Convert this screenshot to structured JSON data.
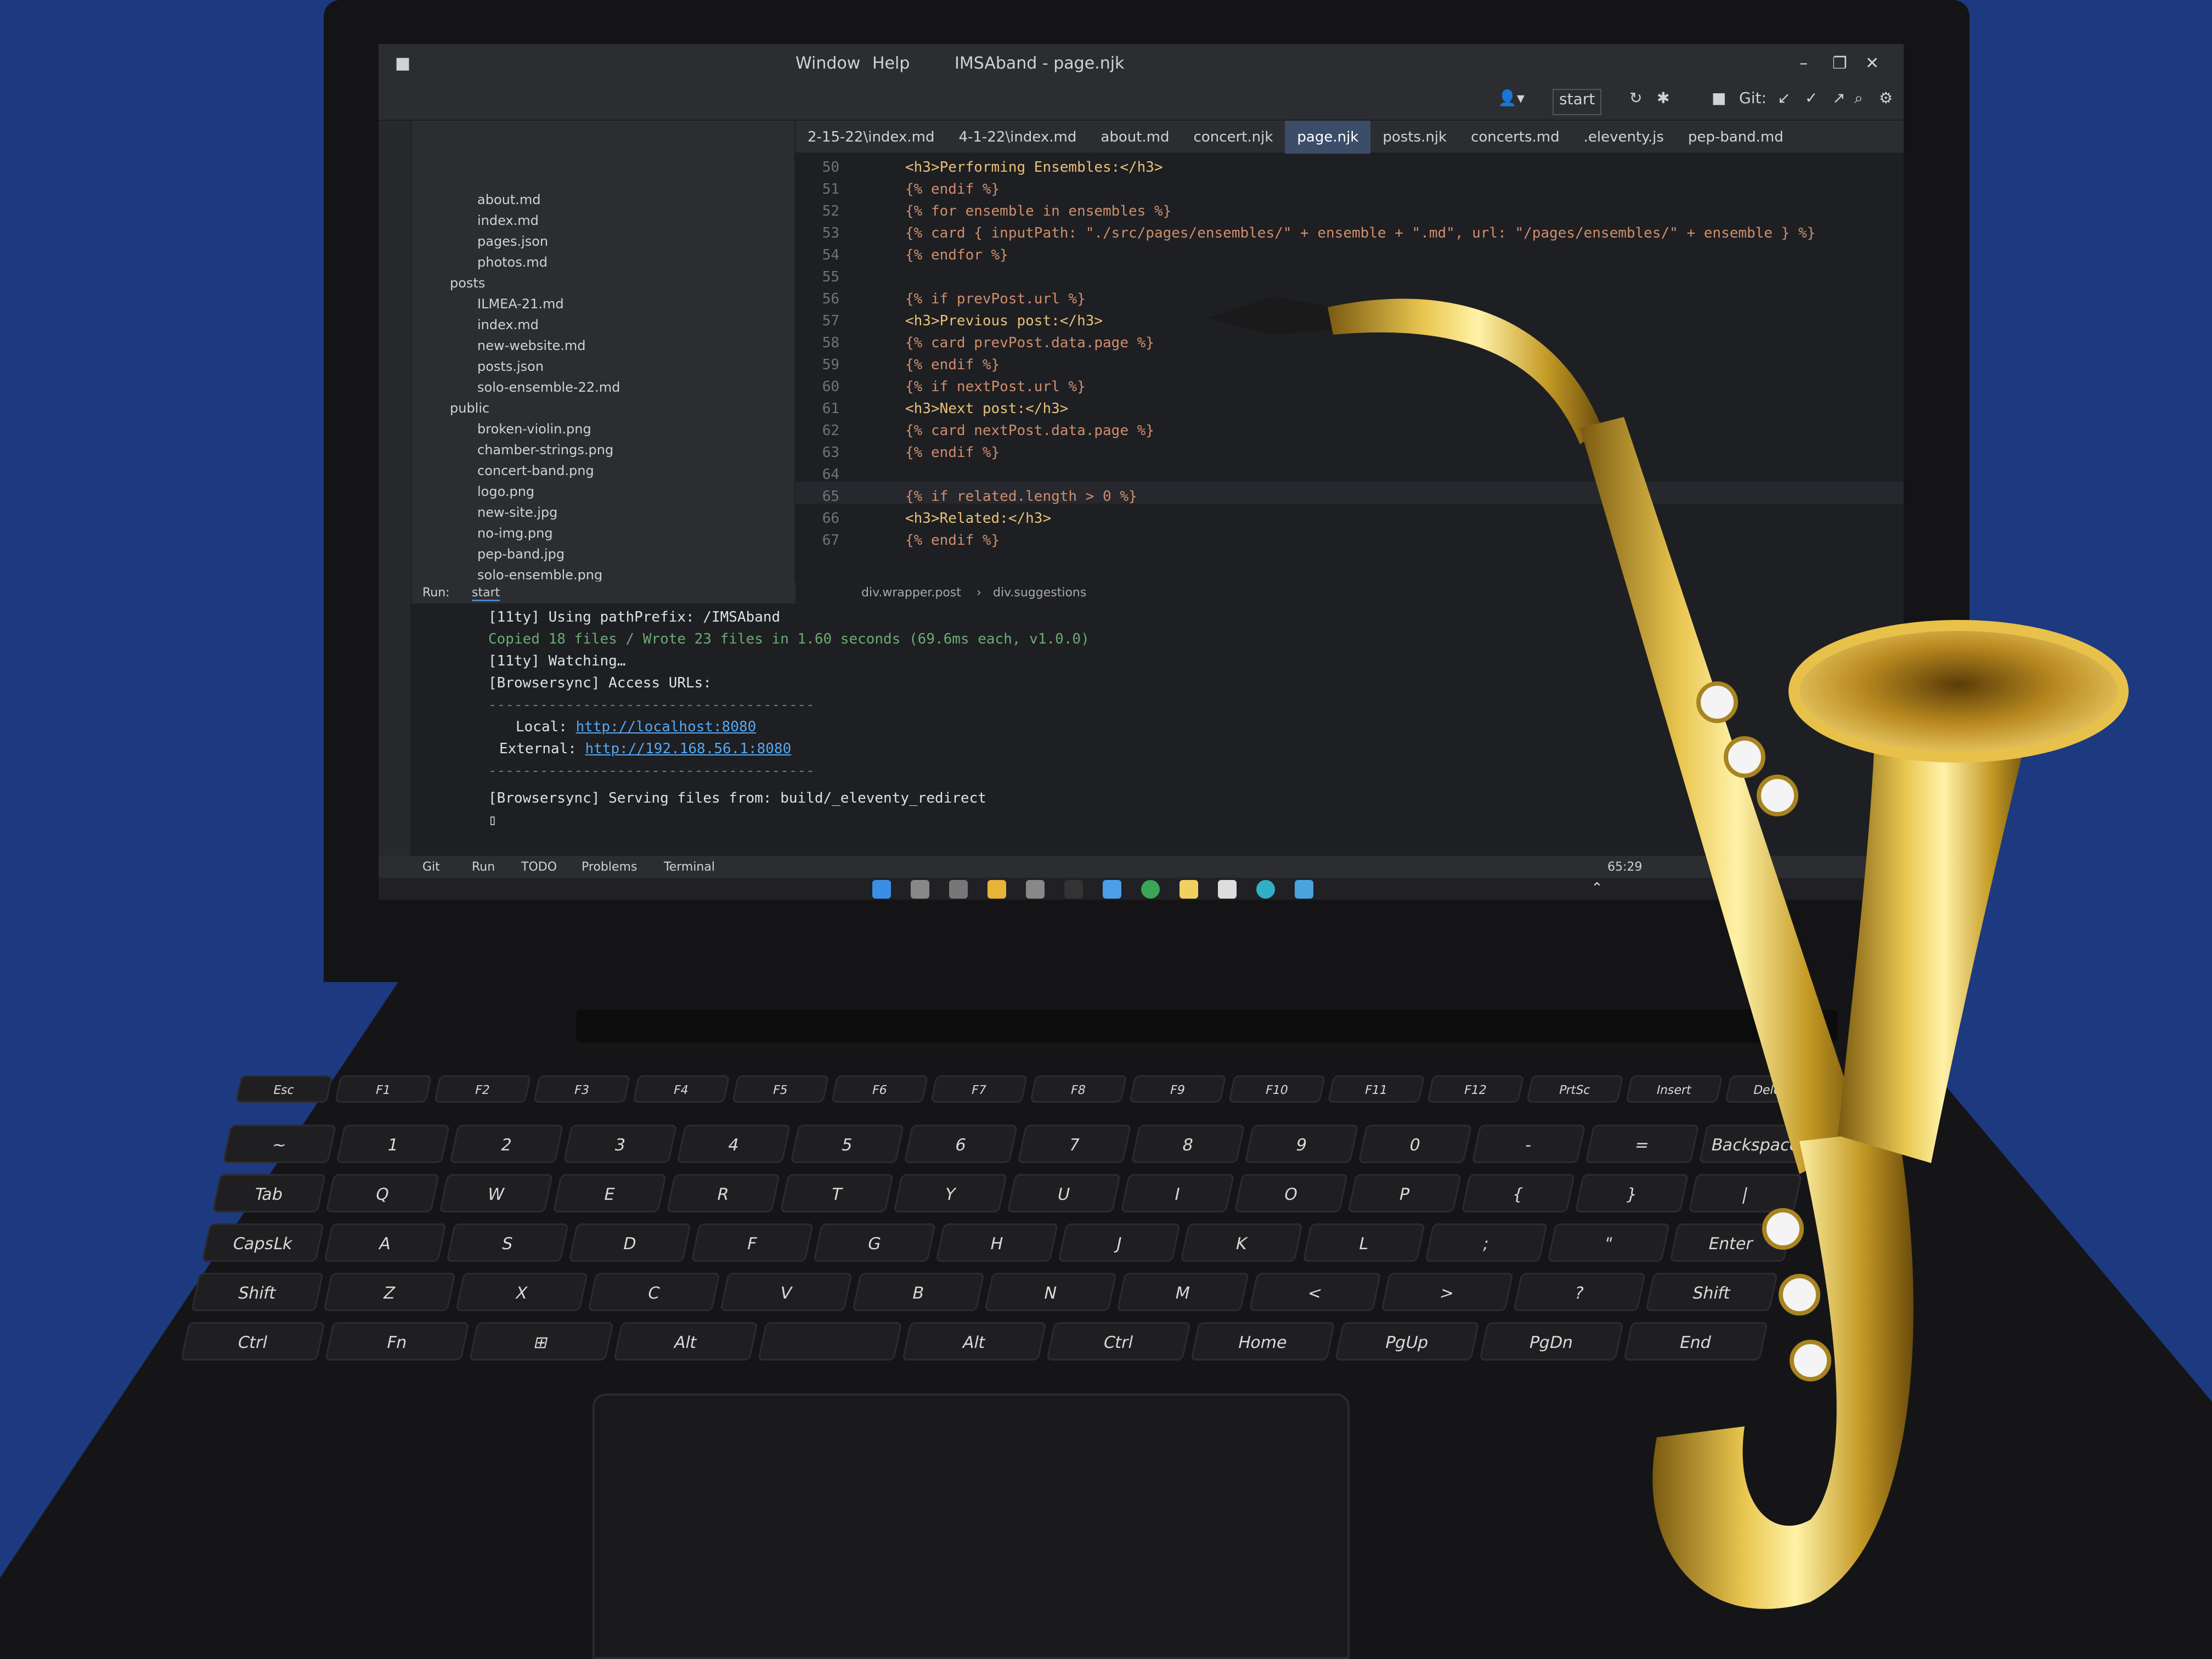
{
  "window": {
    "title": "IMSAband - page.njk",
    "menu": [
      "Window",
      "Help"
    ],
    "run_config": "start",
    "git_label": "Git:"
  },
  "tabs": [
    "2-15-22\\index.md",
    "4-1-22\\index.md",
    "about.md",
    "concert.njk",
    "page.njk",
    "posts.njk",
    "concerts.md",
    ".eleventy.js",
    "pep-band.md"
  ],
  "active_tab": "page.njk",
  "project_tree": {
    "items": [
      "about.md",
      "index.md",
      "pages.json",
      "photos.md",
      "posts",
      "ILMEA-21.md",
      "index.md",
      "new-website.md",
      "posts.json",
      "solo-ensemble-22.md",
      "public",
      "broken-violin.png",
      "chamber-strings.png",
      "concert-band.png",
      "logo.png",
      "new-site.jpg",
      "no-img.png",
      "pep-band.jpg",
      "solo-ensemble.png"
    ]
  },
  "editor": {
    "line_numbers": [
      "50",
      "51",
      "52",
      "53",
      "54",
      "55",
      "56",
      "57",
      "58",
      "59",
      "60",
      "61",
      "62",
      "63",
      "64",
      "65",
      "66",
      "67"
    ],
    "lines": [
      "<h3>Performing Ensembles:</h3>",
      "{% endif %}",
      "{% for ensemble in ensembles %}",
      "{% card { inputPath: \"./src/pages/ensembles/\" + ensemble + \".md\", url: \"/pages/ensembles/\" + ensemble } %}",
      "{% endfor %}",
      "",
      "{% if prevPost.url %}",
      "<h3>Previous post:</h3>",
      "{% card prevPost.data.page %}",
      "{% endif %}",
      "{% if nextPost.url %}",
      "<h3>Next post:</h3>",
      "{% card nextPost.data.page %}",
      "{% endif %}",
      "",
      "{% if related.length > 0 %}",
      "<h3>Related:</h3>",
      "{% endif %}"
    ],
    "breadcrumbs": [
      "div.wrapper.post",
      "div.suggestions"
    ]
  },
  "run_panel": {
    "header": "Run:",
    "tab": "start",
    "lines": [
      "[11ty] Using pathPrefix: /IMSAband",
      "Copied 18 files / Wrote 23 files in 1.60 seconds (69.6ms each, v1.0.0)",
      "[11ty] Watching…",
      "[Browsersync] Access URLs:",
      "--------------------------------------",
      "Local:",
      "External:",
      "--------------------------------------",
      "[Browsersync] Serving files from: build/_eleventy_redirect"
    ],
    "local_url": "http://localhost:8080",
    "external_url": "http://192.168.56.1:8080"
  },
  "status_tabs": [
    "Git",
    "Run",
    "TODO",
    "Problems",
    "Terminal"
  ],
  "cursor_position": "65:29",
  "keyboard": {
    "row1": [
      "Esc",
      "F1",
      "F2",
      "F3",
      "F4",
      "F5",
      "F6",
      "F7",
      "F8",
      "F9",
      "F10",
      "F11",
      "F12",
      "PrtSc",
      "Insert",
      "Delete"
    ],
    "row2": [
      "~",
      "1",
      "2",
      "3",
      "4",
      "5",
      "6",
      "7",
      "8",
      "9",
      "0",
      "-",
      "=",
      "Backspace"
    ],
    "row3": [
      "Tab",
      "Q",
      "W",
      "E",
      "R",
      "T",
      "Y",
      "U",
      "I",
      "O",
      "P",
      "{",
      "}",
      "|"
    ],
    "row4": [
      "CapsLk",
      "A",
      "S",
      "D",
      "F",
      "G",
      "H",
      "J",
      "K",
      "L",
      ";",
      "\"",
      "Enter"
    ],
    "row5": [
      "Shift",
      "Z",
      "X",
      "C",
      "V",
      "B",
      "N",
      "M",
      "<",
      ">",
      "?",
      "Shift"
    ],
    "row6": [
      "Ctrl",
      "Fn",
      "⊞",
      "Alt",
      "",
      "Alt",
      "Ctrl",
      "Home",
      "PgUp",
      "PgDn",
      "End"
    ]
  },
  "colors": {
    "background": "#1d3a80",
    "sax_brass": "#c9a227"
  }
}
